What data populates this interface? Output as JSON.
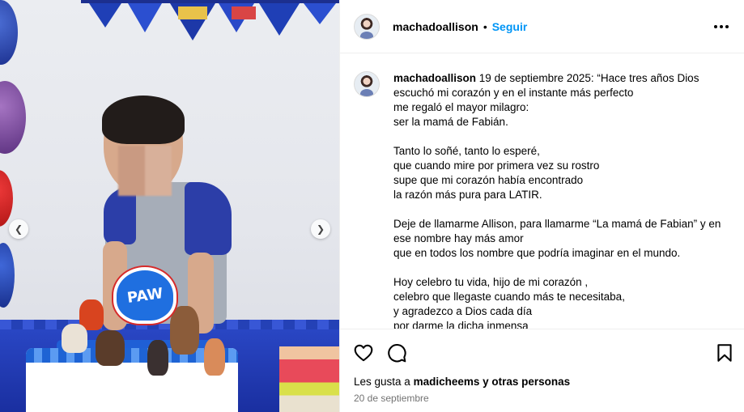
{
  "photo": {
    "badge_text": "PAW",
    "prev_icon": "chevron-left-icon",
    "next_icon": "chevron-right-icon"
  },
  "header": {
    "username": "machadoallison",
    "separator": "•",
    "follow_label": "Seguir",
    "more_icon": "more-options-icon"
  },
  "caption": {
    "username": "machadoallison",
    "text": "19 de septiembre 2025: “Hace tres años Dios escuchó mi corazón y en el instante más perfecto\nme regaló el mayor milagro:\nser la mamá de Fabián.\n\nTanto lo soñé, tanto lo esperé,\nque cuando mire por primera vez su rostro\nsupe que mi corazón había encontrado\nla razón más pura para LATIR.\n\nDeje de llamarme Allison, para llamarme “La mamá de Fabian” y en ese nombre hay más amor\nque en todos los nombre que podría imaginar en el mundo.\n\nHoy celebro tu vida, hijo de mi corazón ,\ncelebro que llegaste cuando más te necesitaba,\ny agradezco a Dios cada día\npor darme la dicha inmensa"
  },
  "actions": {
    "like_icon": "heart-icon",
    "comment_icon": "comment-icon",
    "save_icon": "bookmark-icon",
    "likes_prefix": "Les gusta a",
    "likes_user": "madicheems",
    "likes_suffix": "y otras personas",
    "date": "20 de septiembre"
  },
  "colors": {
    "follow": "#0095f6",
    "date": "#737373",
    "divider": "#efefef"
  }
}
